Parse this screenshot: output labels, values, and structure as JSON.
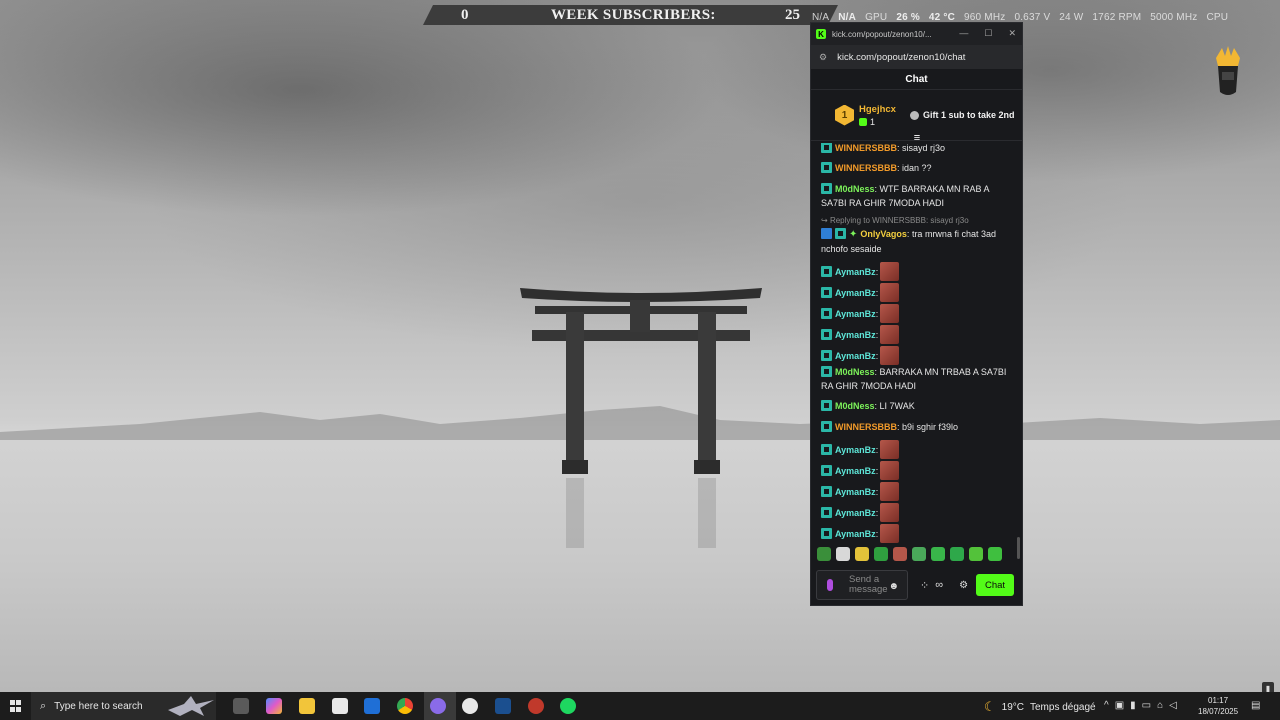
{
  "overlay": {
    "left_count": "0",
    "label": "WEEK SUBSCRIBERS:",
    "right_count": "25",
    "stats": {
      "a": "N/A",
      "b": "N/A",
      "gpu": "GPU",
      "gpu_load": "26 %",
      "gpu_temp": "42 °C",
      "gpu_clock": "960 MHz",
      "gpu_volt": "0.637 V",
      "gpu_power": "24 W",
      "fan": "1762 RPM",
      "mem_clock": "5000 MHz",
      "cpu": "CPU"
    }
  },
  "browser": {
    "title": "kick.com/popout/zenon10/...",
    "url": "kick.com/popout/zenon10/chat",
    "controls": {
      "minimize": "—",
      "maximize": "☐",
      "close": "✕"
    }
  },
  "chat": {
    "header": "Chat",
    "leaderboard": {
      "rank": "1",
      "username": "Hgejhcx",
      "gifts": "1",
      "gift_text": "Gift 1 sub to take 2nd"
    },
    "messages": [
      {
        "user": "WINNERSBBB",
        "text": "sisayd rj3o"
      },
      {
        "user": "WINNERSBBB",
        "text": "idan ??"
      },
      {
        "user": "M0dNess",
        "text": "WTF BARRAKA MN RAB A SA7BI RA GHIR 7MODA HADI"
      },
      {
        "reply": "Replying to WINNERSBBB: sisayd rj3o"
      },
      {
        "user": "OnlyVagos",
        "text": "tra mrwna fi chat 3ad nchofo sesaide"
      },
      {
        "user": "AymanBz",
        "text": ""
      },
      {
        "user": "AymanBz",
        "text": ""
      },
      {
        "user": "AymanBz",
        "text": ""
      },
      {
        "user": "AymanBz",
        "text": ""
      },
      {
        "user": "AymanBz",
        "text": ""
      },
      {
        "user": "M0dNess",
        "text": "BARRAKA MN TRBAB A SA7BI RA GHIR 7MODA HADI"
      },
      {
        "user": "M0dNess",
        "text": "LI 7WAK"
      },
      {
        "user": "WINNERSBBB",
        "text": "b9i sghir f39lo"
      },
      {
        "user": "AymanBz",
        "text": ""
      },
      {
        "user": "AymanBz",
        "text": ""
      },
      {
        "user": "AymanBz",
        "text": ""
      },
      {
        "user": "AymanBz",
        "text": ""
      },
      {
        "user": "AymanBz",
        "text": ""
      }
    ],
    "input_placeholder": "Send a message",
    "send_label": "Chat"
  },
  "taskbar": {
    "search_placeholder": "Type here to search",
    "weather_temp": "19°C",
    "weather_text": "Temps dégagé",
    "time": "01:17",
    "date": "18/07/2025"
  },
  "colors": {
    "kick_green": "#53fc18",
    "gold": "#f2b733",
    "user_green": "#7cf25a",
    "user_orange": "#f19a2a",
    "user_teal": "#5ee6d8"
  },
  "icons": [
    "windows-start-icon",
    "search-icon",
    "task-view-icon",
    "copilot-icon",
    "file-explorer-icon",
    "store-icon",
    "outlook-icon",
    "chrome-icon",
    "steam-icon",
    "spotify-icon",
    "moon-icon",
    "microphone-icon",
    "settings-icon",
    "emoji-icon"
  ]
}
